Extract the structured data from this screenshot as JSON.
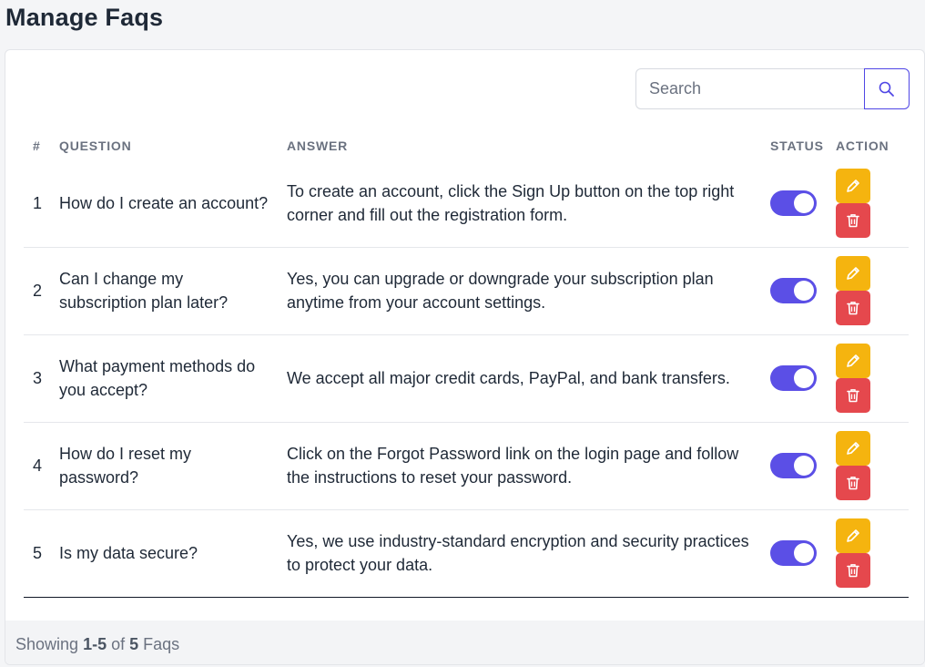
{
  "page": {
    "title": "Manage Faqs"
  },
  "search": {
    "placeholder": "Search",
    "value": ""
  },
  "table": {
    "headers": {
      "num": "#",
      "question": "QUESTION",
      "answer": "ANSWER",
      "status": "STATUS",
      "action": "ACTION"
    },
    "rows": [
      {
        "num": "1",
        "question": "How do I create an account?",
        "answer": "To create an account, click the Sign Up button on the top right corner and fill out the registration form.",
        "status_on": true
      },
      {
        "num": "2",
        "question": "Can I change my subscription plan later?",
        "answer": "Yes, you can upgrade or downgrade your subscription plan anytime from your account settings.",
        "status_on": true
      },
      {
        "num": "3",
        "question": "What payment methods do you accept?",
        "answer": "We accept all major credit cards, PayPal, and bank transfers.",
        "status_on": true
      },
      {
        "num": "4",
        "question": "How do I reset my password?",
        "answer": "Click on the Forgot Password link on the login page and follow the instructions to reset your password.",
        "status_on": true
      },
      {
        "num": "5",
        "question": "Is my data secure?",
        "answer": "Yes, we use industry-standard encryption and security practices to protect your data.",
        "status_on": true
      }
    ]
  },
  "footer": {
    "prefix": "Showing",
    "range": "1-5",
    "of": "of",
    "total": "5",
    "suffix": "Faqs"
  },
  "icons": {
    "search": "search-icon",
    "edit": "pencil-icon",
    "delete": "trash-icon"
  },
  "colors": {
    "accent": "#5b4fe6",
    "edit": "#f5b40f",
    "delete": "#e5484d"
  }
}
